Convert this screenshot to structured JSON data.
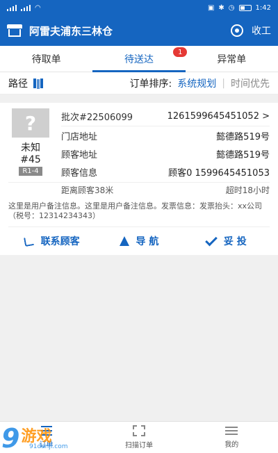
{
  "status_bar": {
    "time": "1:42"
  },
  "header": {
    "title": "阿雷夫浦东三林仓",
    "logout_label": "收工"
  },
  "tabs": [
    {
      "label": "待取单"
    },
    {
      "label": "待送达",
      "badge": "1"
    },
    {
      "label": "异常单"
    }
  ],
  "filter": {
    "route_label": "路径",
    "sort_label": "订单排序:",
    "sort_active": "系统规划",
    "sort_other": "时间优先"
  },
  "order": {
    "avatar_glyph": "?",
    "status": "未知",
    "number": "#45",
    "tag": "R1-4",
    "batch": "批次#22506099",
    "batch_id": "1261599645451052 >",
    "store_label": "门店地址",
    "store_value": "懿德路519号",
    "customer_addr_label": "顾客地址",
    "customer_addr_value": "懿德路519号",
    "customer_info_label": "顾客信息",
    "customer_info_value": "顾客0 1599645451053",
    "distance": "距离顾客38米",
    "timeout": "超时18小时",
    "remark": "这里是用户备注信息。这里是用户备注信息。发票信息：发票抬头：xx公司（税号：12314234343）"
  },
  "actions": {
    "contact": "联系顾客",
    "navigate": "导 航",
    "deliver": "妥 投"
  },
  "bottom_nav": {
    "orders": "订单",
    "scan": "扫描订单",
    "me": "我的"
  },
  "watermark": {
    "big": "9",
    "text": "游戏",
    "url": "91danji.com"
  },
  "colors": {
    "primary": "#1565c0",
    "badge": "#e53935"
  }
}
